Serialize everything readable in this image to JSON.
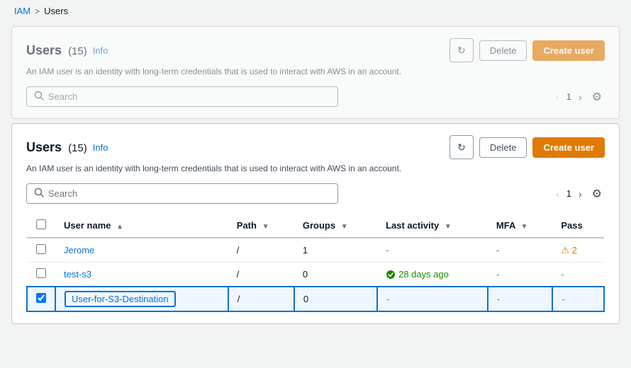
{
  "breadcrumb": {
    "parent_label": "IAM",
    "separator": ">",
    "current_label": "Users"
  },
  "panel": {
    "title": "Users",
    "count": "(15)",
    "info_label": "Info",
    "description": "An IAM user is an identity with long-term credentials that is used to interact with AWS in an account.",
    "refresh_label": "↻",
    "delete_label": "Delete",
    "create_user_label": "Create user",
    "search_placeholder": "Search",
    "pagination": {
      "prev_label": "‹",
      "page": "1",
      "next_label": "›",
      "settings_label": "⚙"
    }
  },
  "table": {
    "columns": [
      {
        "id": "checkbox",
        "label": ""
      },
      {
        "id": "username",
        "label": "User name",
        "sort": "asc"
      },
      {
        "id": "path",
        "label": "Path",
        "sort": "desc"
      },
      {
        "id": "groups",
        "label": "Groups",
        "sort": "desc"
      },
      {
        "id": "last_activity",
        "label": "Last activity",
        "sort": "desc"
      },
      {
        "id": "mfa",
        "label": "MFA",
        "sort": "desc"
      },
      {
        "id": "pass",
        "label": "Pass"
      }
    ],
    "rows": [
      {
        "id": "jerome",
        "username": "Jerome",
        "path": "/",
        "groups": "1",
        "last_activity": "-",
        "mfa": "-",
        "pass": "⚠ 2",
        "pass_class": "warning",
        "selected": false
      },
      {
        "id": "test-s3",
        "username": "test-s3",
        "path": "/",
        "groups": "0",
        "last_activity": "28 days ago",
        "last_activity_ok": true,
        "mfa": "-",
        "pass": "-",
        "pass_class": "normal",
        "selected": false
      },
      {
        "id": "user-for-s3-destination",
        "username": "User-for-S3-Destination",
        "path": "/",
        "groups": "0",
        "last_activity": "-",
        "last_activity_ok": false,
        "mfa": "-",
        "pass": "-",
        "pass_class": "normal",
        "selected": true
      }
    ]
  }
}
